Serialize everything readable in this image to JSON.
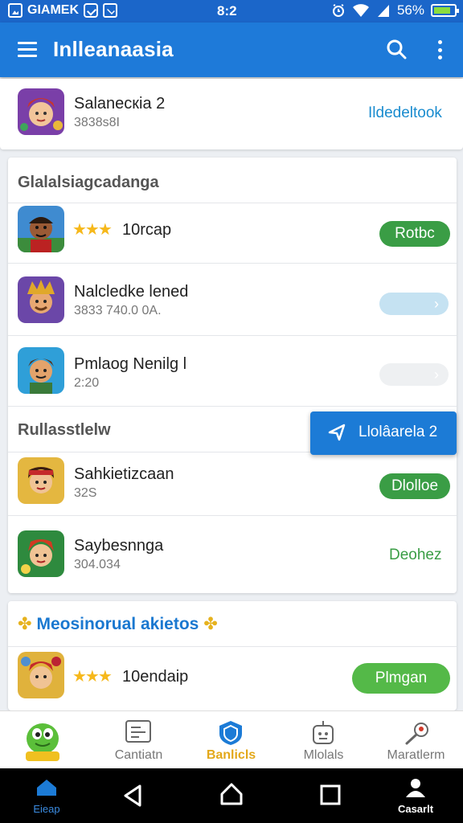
{
  "status_bar": {
    "app_name": "GIAMEK",
    "time": "8:2",
    "battery": "56%"
  },
  "app_bar": {
    "title": "Inlleanaasia"
  },
  "featured": {
    "name": "Salanecкia 2",
    "sub": "3838s8I",
    "action": "Ildedeltook"
  },
  "section1": {
    "title": "Glalalsiagcadanga",
    "items": [
      {
        "name": "10rcap",
        "rating": "★★★",
        "action": "Rotbc"
      },
      {
        "name": "Nalcledke lened",
        "sub": "3833 740.0 0A.",
        "action": "›"
      },
      {
        "name": "Pmlaog Nenilg l",
        "sub": "2:20",
        "action": "›"
      }
    ]
  },
  "section2": {
    "title": "Rullasstlelw",
    "floating_action": "Llolâarela 2",
    "items": [
      {
        "name": "Sahkietizcaan",
        "sub": "32S",
        "action": "Dlolloe"
      },
      {
        "name": "Saybesnnga",
        "sub": "304.034",
        "action": "Deohez"
      }
    ]
  },
  "section3": {
    "title": "Meosinorual akietos",
    "items": [
      {
        "name": "10endaip",
        "rating": "★★★",
        "action": "Plmgan"
      }
    ]
  },
  "tabs": [
    {
      "label": "",
      "icon": "mascot-icon"
    },
    {
      "label": "Cantiatn",
      "icon": "card-icon"
    },
    {
      "label": "Banlicls",
      "icon": "shield-icon",
      "active": true
    },
    {
      "label": "Mlolals",
      "icon": "robot-icon"
    },
    {
      "label": "Maratlerm",
      "icon": "search-person-icon"
    }
  ],
  "system_nav": {
    "home_label": "Eieap",
    "account_label": "Casarlt"
  },
  "colors": {
    "primary": "#1e7ad9",
    "status_bar": "#1b66c9",
    "green": "#3a9d45",
    "star": "#f6b81b",
    "active_tab": "#e3a81a"
  }
}
